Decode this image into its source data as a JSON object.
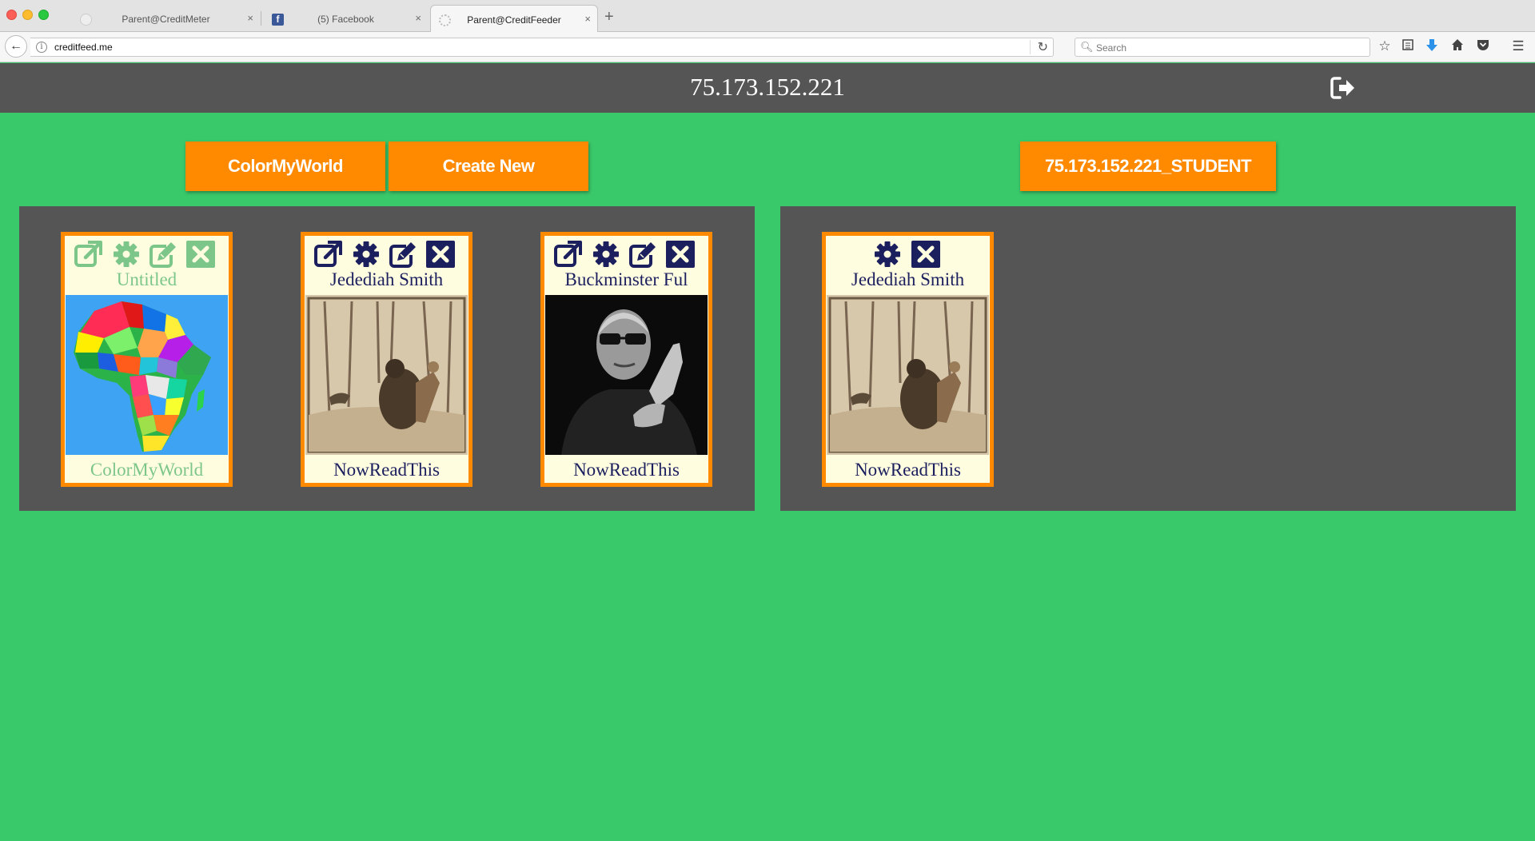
{
  "browser": {
    "tabs": [
      {
        "title": "Parent@CreditMeter",
        "favicon": "blank-globe-icon",
        "active": false
      },
      {
        "title": "(5) Facebook",
        "favicon": "facebook-icon",
        "active": false
      },
      {
        "title": "Parent@CreditFeeder",
        "favicon": "loading-icon",
        "active": true
      }
    ],
    "tab_close": "×",
    "new_tab": "+",
    "back": "←",
    "url": "creditfeed.me",
    "url_info": "i",
    "search_placeholder": "Search"
  },
  "header": {
    "title": "75.173.152.221",
    "logout_icon": "sign-out-icon"
  },
  "toolbar": {
    "colormyworld_label": "ColorMyWorld",
    "create_new_label": "Create New",
    "student_label": "75.173.152.221_STUDENT"
  },
  "parent_cards": [
    {
      "name": "Untitled",
      "app": "ColorMyWorld",
      "image": "africa-map",
      "tools_faded": true
    },
    {
      "name": "Jedediah Smith",
      "app": "NowReadThis",
      "image": "bear-sketch",
      "tools_faded": false
    },
    {
      "name": "Buckminster Ful",
      "app": "NowReadThis",
      "image": "portrait-photo",
      "tools_faded": false
    }
  ],
  "student_cards": [
    {
      "name": "Jedediah Smith",
      "app": "NowReadThis",
      "image": "bear-sketch"
    }
  ],
  "colors": {
    "background": "#3ac96a",
    "header": "#555555",
    "accent": "#ff8a00",
    "card": "#fffde0",
    "card_text": "#1b1f5e",
    "faded": "#7dc68a"
  }
}
